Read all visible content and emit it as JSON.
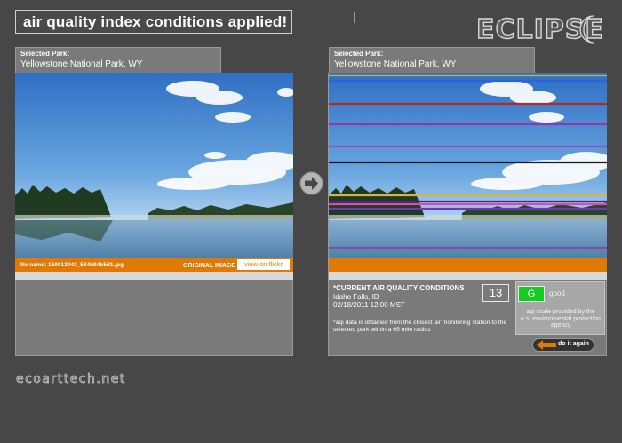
{
  "header": {
    "title": "air quality index conditions applied!",
    "logo_text": "ECLIPSE"
  },
  "left_panel": {
    "selected_label": "Selected Park:",
    "park_name": "Yellowstone National Park, WY",
    "file_name": "file name: 160013943_534b94b5d1.jpg",
    "image_label": "ORIGINAL IMAGE",
    "flickr_button": "view on flickr"
  },
  "right_panel": {
    "selected_label": "Selected Park:",
    "park_name": "Yellowstone National Park, WY",
    "conditions_title": "*CURRENT AIR QUALITY CONDITIONS",
    "location": "Idaho Falls, ID",
    "datetime": "02/18/2011 12:00 MST",
    "aqi_value": "13",
    "grade_letter": "G",
    "grade_text": "good",
    "scale_note": "aqi scale provided by the u.s. environmental protection agency",
    "data_note": "*aqi data is obtained from the closest air monitoring station to the selected park within a 65 mile radius",
    "again_button": "do it again"
  },
  "footer": {
    "site": "ecoarttech.net"
  },
  "colors": {
    "background": "#474747",
    "accent_orange": "#e07a06",
    "good_green": "#16cc22"
  },
  "icons": {
    "transfer": "arrow-right-circle-icon",
    "back": "arrow-left-icon",
    "logo_mark": "crescent-moon-icon"
  }
}
